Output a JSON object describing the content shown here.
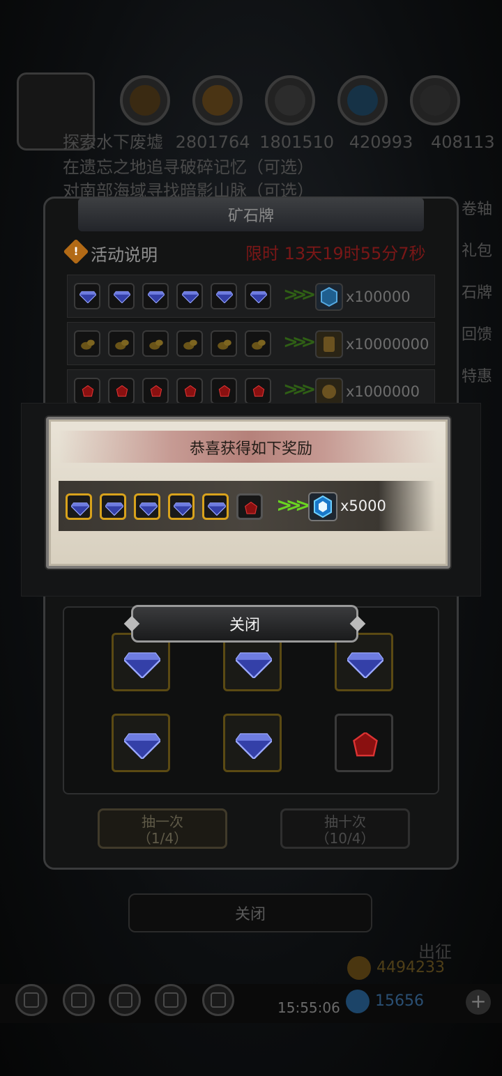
{
  "background": {
    "resources": [
      "2801764",
      "1801510",
      "420993",
      "408113"
    ],
    "quest_lines": [
      "探索水下废墟",
      "在遗忘之地追寻破碎记忆（可选）",
      "对南部海域寻找暗影山脉（可选）"
    ],
    "side_menu": [
      "卷轴",
      "礼包",
      "石牌",
      "回馈",
      "特惠"
    ],
    "bottom": {
      "time": "15:55:06",
      "gold": "4494233",
      "gems": "15656",
      "expedition": "出征",
      "close_label": "关闭"
    }
  },
  "panel": {
    "title": "矿石牌",
    "info_label": "活动说明",
    "timer": "限时 13天19时55分7秒",
    "recipes": [
      {
        "input": "blue-gem",
        "result": "blue-crystal-icon",
        "qty": "x100000"
      },
      {
        "input": "gold-nugget",
        "result": "gold-scroll-icon",
        "qty": "x10000000"
      },
      {
        "input": "red-gem",
        "result": "gold-coin-icon",
        "qty": "x1000000"
      }
    ],
    "draw_once": "抽一次",
    "draw_once_count": "（1/4）",
    "draw_ten": "抽十次",
    "draw_ten_count": "（10/4）"
  },
  "reward_popup": {
    "title": "恭喜获得如下奖励",
    "qty": "x5000",
    "close_label": "关闭"
  },
  "colors": {
    "gold_border": "#d8a21c",
    "arrow_green": "#6ad322",
    "timer_red": "#7a1717"
  }
}
